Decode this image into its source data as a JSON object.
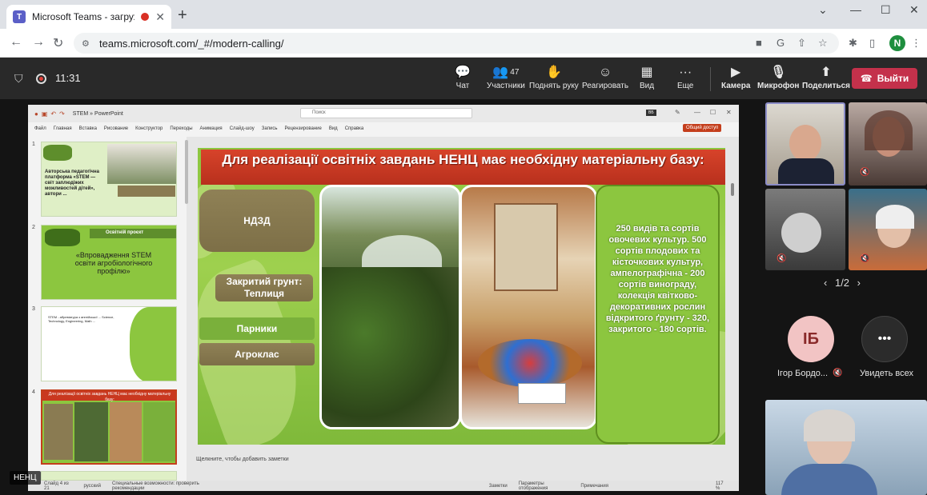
{
  "browser": {
    "tab_title": "Microsoft Teams - загружае",
    "url": "teams.microsoft.com/_#/modern-calling/",
    "profile_initial": "N"
  },
  "meeting": {
    "timer": "11:31",
    "chat": "Чат",
    "participants": "Участники",
    "participants_count": "47",
    "raise_hand": "Поднять руку",
    "react": "Реагировать",
    "view": "Вид",
    "more": "Еще",
    "camera": "Камера",
    "mic": "Микрофон",
    "share": "Поделиться",
    "leave": "Выйти"
  },
  "ppt": {
    "doc_title": "STEM » PowerPoint",
    "search": "Поиск",
    "menu": [
      "Файл",
      "Главная",
      "Вставка",
      "Рисование",
      "Конструктор",
      "Переходы",
      "Анимация",
      "Слайд-шоу",
      "Запись",
      "Рецензирование",
      "Вид",
      "Справка"
    ],
    "share_btn": "Общий доступ",
    "notes_placeholder": "Щелкните, чтобы добавить заметки",
    "status": [
      "Слайд 4 из 21",
      "русский",
      "Специальные возможности: проверить рекомендации",
      "Заметки",
      "Параметры отображения",
      "Примечания",
      "117 %"
    ],
    "thumbs": {
      "t1_text": "Авторська педагогічна платформа «STEM — світ заплюдіжих можливостей дітей», автори ...",
      "t2_band": "Освітній проєкт",
      "t2_text": "«Впровадження STEM освіти агробіологічного профілю»",
      "t3_text": "STEM - абревіатура з англійської ... Science, Technology, Engineering, Math ...",
      "t4_band": "Для реалізації освітніх завдань НЕНЦ має необхідну матеріальну базу:"
    }
  },
  "slide": {
    "title": "Для реалізації освітніх завдань НЕНЦ має необхідну матеріальну базу:",
    "ndzd": "НДЗД",
    "closed_ground": "Закритий грунт: Теплиця",
    "parniki": "Парники",
    "agroklas": "Агроклас",
    "right_text": "250 видів та сортів овочевих культур. 500 сортів плодових та кісточкових культур, ампелографічна - 200 сортів винограду, колекція  квітково-декоративних рослин відкритого ґрунту - 320, закритого - 180 сортів."
  },
  "participants": {
    "pager": "1/2",
    "avatar_initials": "ІБ",
    "avatar_name": "Ігор Бордо...",
    "see_all": "Увидеть всех",
    "presenter_label": "НЕНЦ"
  }
}
